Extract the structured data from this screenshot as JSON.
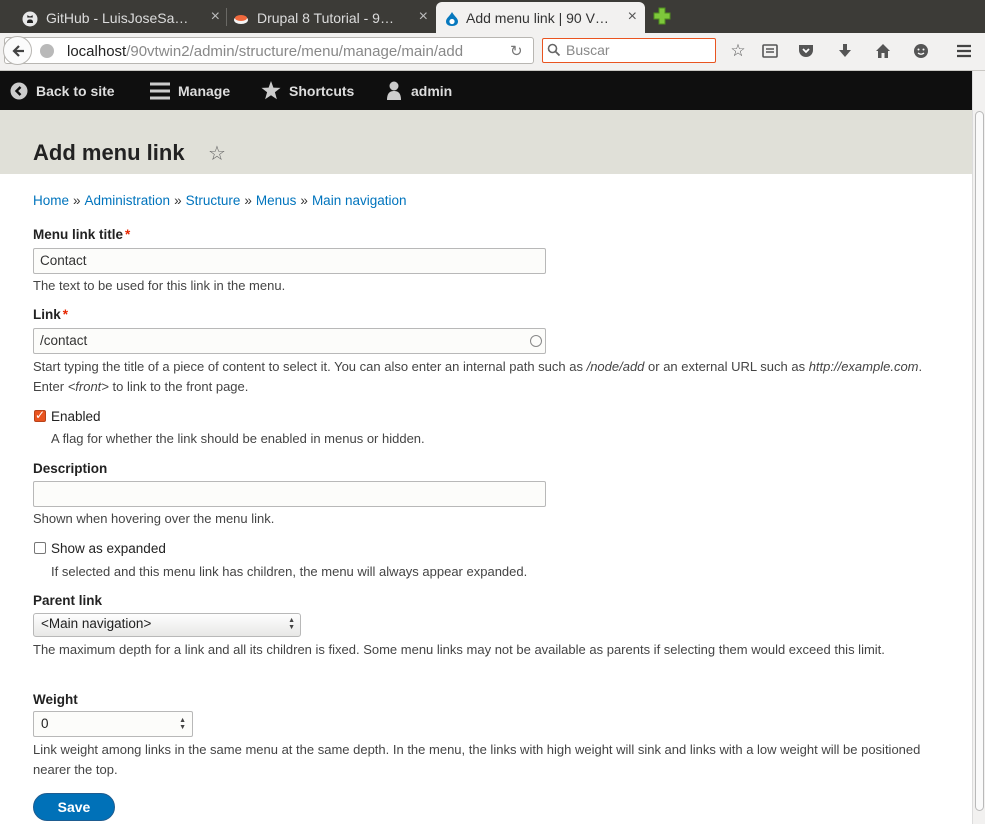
{
  "browser": {
    "tabs": [
      {
        "title": "GitHub - LuisJoseSa…",
        "close": "×"
      },
      {
        "title": "Drupal 8 Tutorial - 9…",
        "close": "×"
      },
      {
        "title": "Add menu link | 90 V…",
        "close": "×"
      }
    ],
    "new_tab": "+",
    "url_host": "localhost",
    "url_path": "/90vtwin2/admin/structure/menu/manage/main/add",
    "search_placeholder": "Buscar"
  },
  "toolbar": {
    "back_to_site": "Back to site",
    "manage": "Manage",
    "shortcuts": "Shortcuts",
    "user": "admin"
  },
  "page": {
    "title": "Add menu link",
    "star": "☆"
  },
  "breadcrumb": [
    "Home",
    "Administration",
    "Structure",
    "Menus",
    "Main navigation"
  ],
  "breadcrumb_sep": "»",
  "form": {
    "title_label": "Menu link title",
    "required_mark": "*",
    "title_value": "Contact",
    "title_desc": "The text to be used for this link in the menu.",
    "link_label": "Link",
    "link_value": "/contact",
    "link_desc_1": "Start typing the title of a piece of content to select it. You can also enter an internal path such as ",
    "link_desc_em1": "/node/add",
    "link_desc_2": " or an external URL such as ",
    "link_desc_em2": "http://example.com",
    "link_desc_3": ". Enter ",
    "link_desc_em3": "<front>",
    "link_desc_4": " to link to the front page.",
    "enabled_label": "Enabled",
    "enabled_checked": true,
    "enabled_desc": "A flag for whether the link should be enabled in menus or hidden.",
    "description_label": "Description",
    "description_value": "",
    "description_desc": "Shown when hovering over the menu link.",
    "expanded_label": "Show as expanded",
    "expanded_checked": false,
    "expanded_desc": "If selected and this menu link has children, the menu will always appear expanded.",
    "parent_label": "Parent link",
    "parent_value": "<Main navigation>",
    "parent_desc": "The maximum depth for a link and all its children is fixed. Some menu links may not be available as parents if selecting them would exceed this limit.",
    "weight_label": "Weight",
    "weight_value": "0",
    "weight_desc": "Link weight among links in the same menu at the same depth. In the menu, the links with high weight will sink and links with a low weight will be positioned nearer the top.",
    "save_label": "Save"
  },
  "colors": {
    "link": "#0074bd",
    "required": "#e62600",
    "save_button": "#0071b8",
    "checkbox_checked": "#e9541f",
    "toolbar_bg": "#0f0f0f",
    "header_bg": "#e0e0d8"
  }
}
